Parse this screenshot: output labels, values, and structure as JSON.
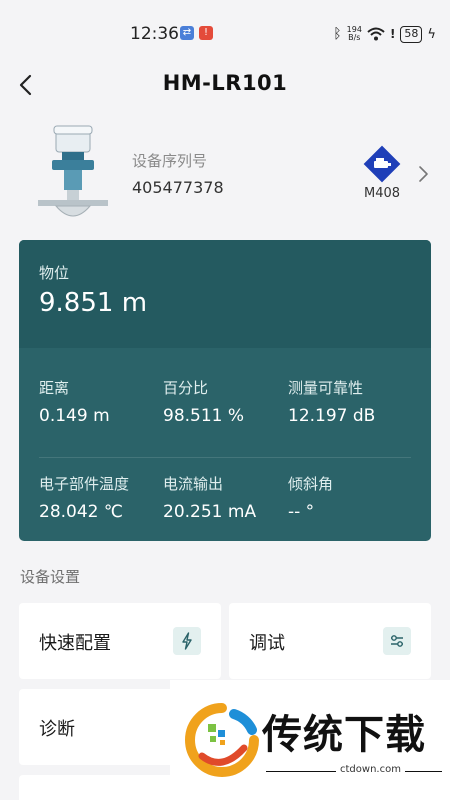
{
  "status_bar": {
    "time": "12:36",
    "net_speed_value": "194",
    "net_speed_unit": "B/s",
    "battery": "58"
  },
  "header": {
    "title": "HM-LR101"
  },
  "device": {
    "serial_label": "设备序列号",
    "serial_value": "405477378",
    "model": "M408"
  },
  "measurements": {
    "primary": {
      "label": "物位",
      "value": "9.851 m"
    },
    "row1": [
      {
        "label": "距离",
        "value": "0.149 m"
      },
      {
        "label": "百分比",
        "value": "98.511 %"
      },
      {
        "label": "测量可靠性",
        "value": "12.197 dB"
      }
    ],
    "row2": [
      {
        "label": "电子部件温度",
        "value": "28.042 ℃"
      },
      {
        "label": "电流输出",
        "value": "20.251 mA"
      },
      {
        "label": "倾斜角",
        "value": "-- °"
      }
    ]
  },
  "settings": {
    "title": "设备设置",
    "tiles": [
      {
        "label": "快速配置"
      },
      {
        "label": "调试"
      },
      {
        "label": "诊断"
      }
    ]
  },
  "watermark": {
    "text": "传统下载",
    "url": "ctdown.com"
  },
  "colors": {
    "card": "#2b6369",
    "card_top": "#245a60",
    "model_icon": "#1f3fb8",
    "tile_icon_bg": "#e3f0ef"
  }
}
